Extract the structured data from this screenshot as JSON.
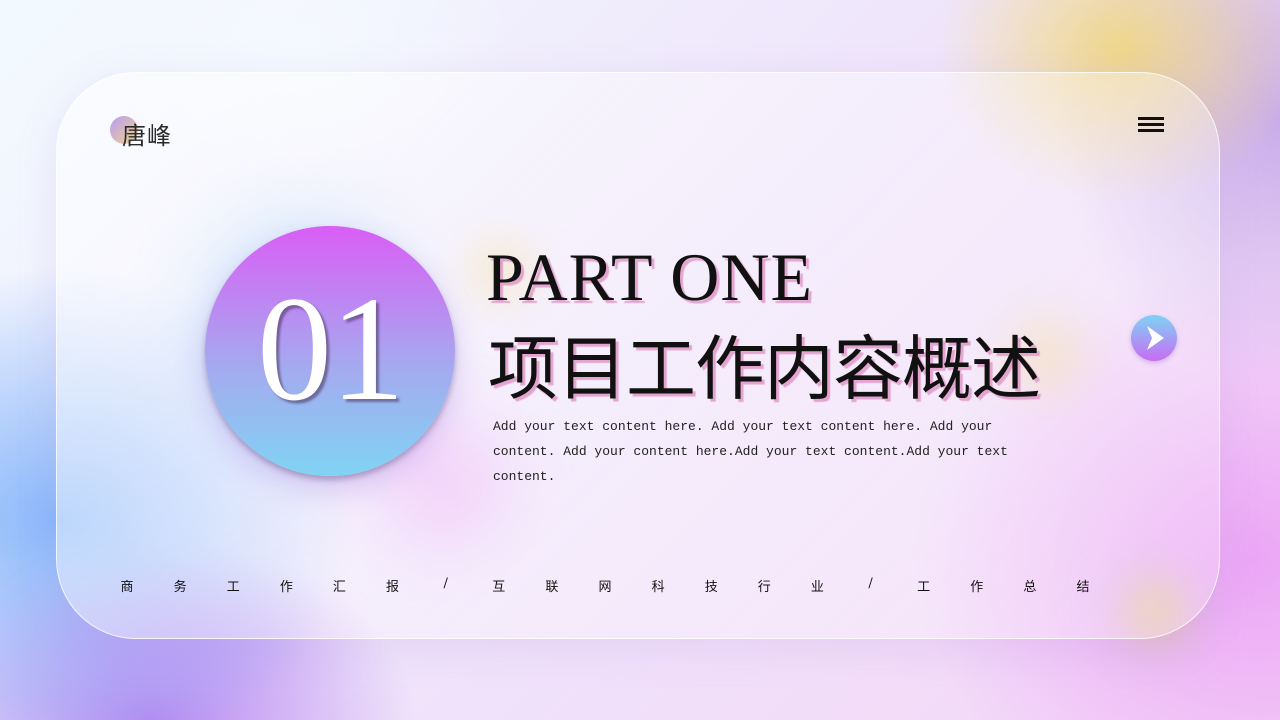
{
  "logo": {
    "text": "唐峰"
  },
  "icons": {
    "menu": "menu-icon",
    "next": "play-arrow-icon"
  },
  "section": {
    "number": "01",
    "part": "PART ONE",
    "title": "项目工作内容概述",
    "description": "Add your text content here. Add your text content here. Add your content. Add your content here.Add your text content.Add your text content."
  },
  "footer": {
    "chars": [
      "商",
      "务",
      "工",
      "作",
      "汇",
      "报",
      "/",
      "互",
      "联",
      "网",
      "科",
      "技",
      "行",
      "业",
      "/",
      "工",
      "作",
      "总",
      "结"
    ]
  },
  "colors": {
    "circle_top": "#d95ef5",
    "circle_bottom": "#80d3f3",
    "title_shadow": "#e196c8"
  }
}
